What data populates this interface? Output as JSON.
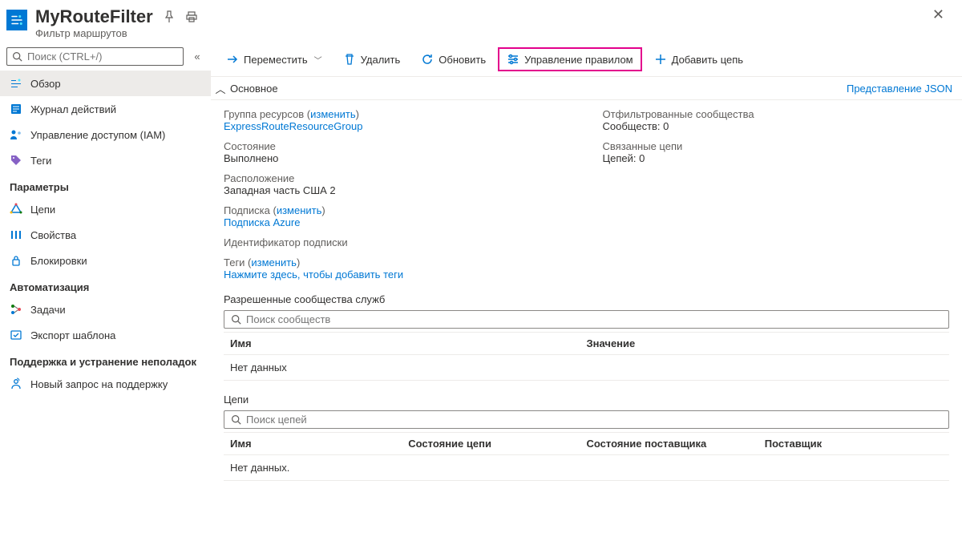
{
  "header": {
    "title": "MyRouteFilter",
    "subtitle": "Фильтр маршрутов"
  },
  "sidebar": {
    "search_placeholder": "Поиск (CTRL+/)",
    "items_top": [
      {
        "label": "Обзор",
        "icon": "overview"
      },
      {
        "label": "Журнал действий",
        "icon": "log"
      },
      {
        "label": "Управление доступом (IAM)",
        "icon": "iam"
      },
      {
        "label": "Теги",
        "icon": "tag"
      }
    ],
    "group_parameters": "Параметры",
    "items_params": [
      {
        "label": "Цепи",
        "icon": "circuits"
      },
      {
        "label": "Свойства",
        "icon": "props"
      },
      {
        "label": "Блокировки",
        "icon": "locks"
      }
    ],
    "group_automation": "Автоматизация",
    "items_auto": [
      {
        "label": "Задачи",
        "icon": "tasks"
      },
      {
        "label": "Экспорт шаблона",
        "icon": "export"
      }
    ],
    "group_support": "Поддержка и устранение неполадок",
    "items_support": [
      {
        "label": "Новый запрос на поддержку",
        "icon": "support"
      }
    ]
  },
  "toolbar": {
    "move": "Переместить",
    "delete": "Удалить",
    "refresh": "Обновить",
    "manage_rule": "Управление правилом",
    "add_circuit": "Добавить цепь"
  },
  "essentials": {
    "header": "Основное",
    "json_link": "Представление JSON",
    "left": {
      "resource_group_label": "Группа ресурсов (",
      "change": "изменить",
      "close": ")",
      "resource_group_value": "ExpressRouteResourceGroup",
      "state_label": "Состояние",
      "state_value": "Выполнено",
      "location_label": "Расположение",
      "location_value": "Западная часть США 2",
      "subscription_label": "Подписка (",
      "subscription_value": "Подписка Azure",
      "subid_label": "Идентификатор подписки",
      "subid_value": ""
    },
    "right": {
      "communities_label": "Отфильтрованные сообщества",
      "communities_value": "Сообществ: 0",
      "circuits_label": "Связанные цепи",
      "circuits_value": "Цепей: 0"
    },
    "tags": {
      "label": "Теги (",
      "change": "изменить",
      "close": ")",
      "link": "Нажмите здесь, чтобы добавить теги"
    }
  },
  "sections": {
    "allowed": {
      "title": "Разрешенные сообщества служб",
      "search_placeholder": "Поиск сообществ",
      "cols": [
        "Имя",
        "Значение"
      ],
      "empty": "Нет данных"
    },
    "circuits": {
      "title": "Цепи",
      "search_placeholder": "Поиск цепей",
      "cols": [
        "Имя",
        "Состояние цепи",
        "Состояние поставщика",
        "Поставщик"
      ],
      "empty": "Нет данных."
    }
  }
}
